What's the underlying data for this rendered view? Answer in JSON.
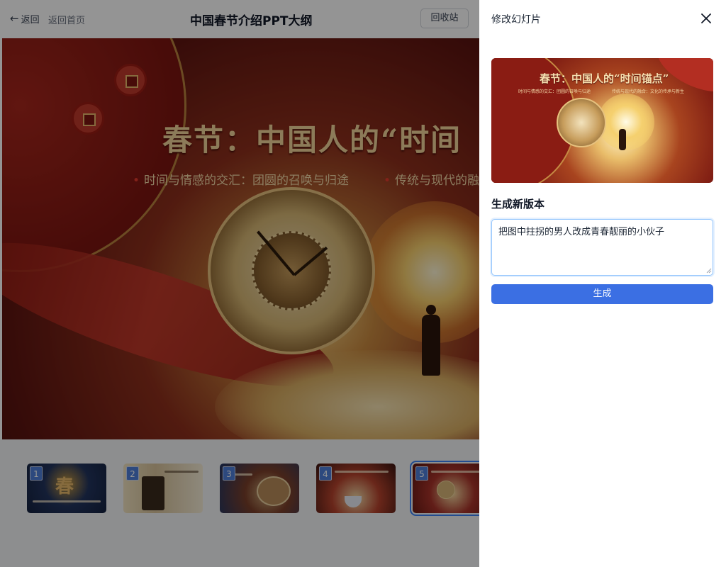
{
  "header": {
    "back_label": "返回",
    "home_label": "返回首页",
    "title": "中国春节介绍PPT大纲",
    "recycle_label": "回收站"
  },
  "main_slide": {
    "title": "春节：中国人的“时间",
    "bullets": [
      "时间与情感的交汇：团圆的召唤与归途",
      "传统与现代的融合"
    ]
  },
  "thumbnails": [
    {
      "number": "1",
      "selected": false,
      "mark": "春"
    },
    {
      "number": "2",
      "selected": false
    },
    {
      "number": "3",
      "selected": false
    },
    {
      "number": "4",
      "selected": false
    },
    {
      "number": "5",
      "selected": true
    }
  ],
  "drawer": {
    "title": "修改幻灯片",
    "close_icon": "close-icon",
    "preview": {
      "title": "春节：中国人的“时间锚点”",
      "bullets": [
        "时间与情感的交汇：团圆的召唤与归途",
        "传统与现代的融合：文化的传承与新生"
      ]
    },
    "section_title": "生成新版本",
    "prompt_value": "把图中拄拐的男人改成青春靓丽的小伙子",
    "generate_label": "生成"
  },
  "colors": {
    "accent": "#3b6fe3",
    "overlay": "rgba(0,0,0,0.42)",
    "thumb_badge": "#4f7fd9"
  }
}
